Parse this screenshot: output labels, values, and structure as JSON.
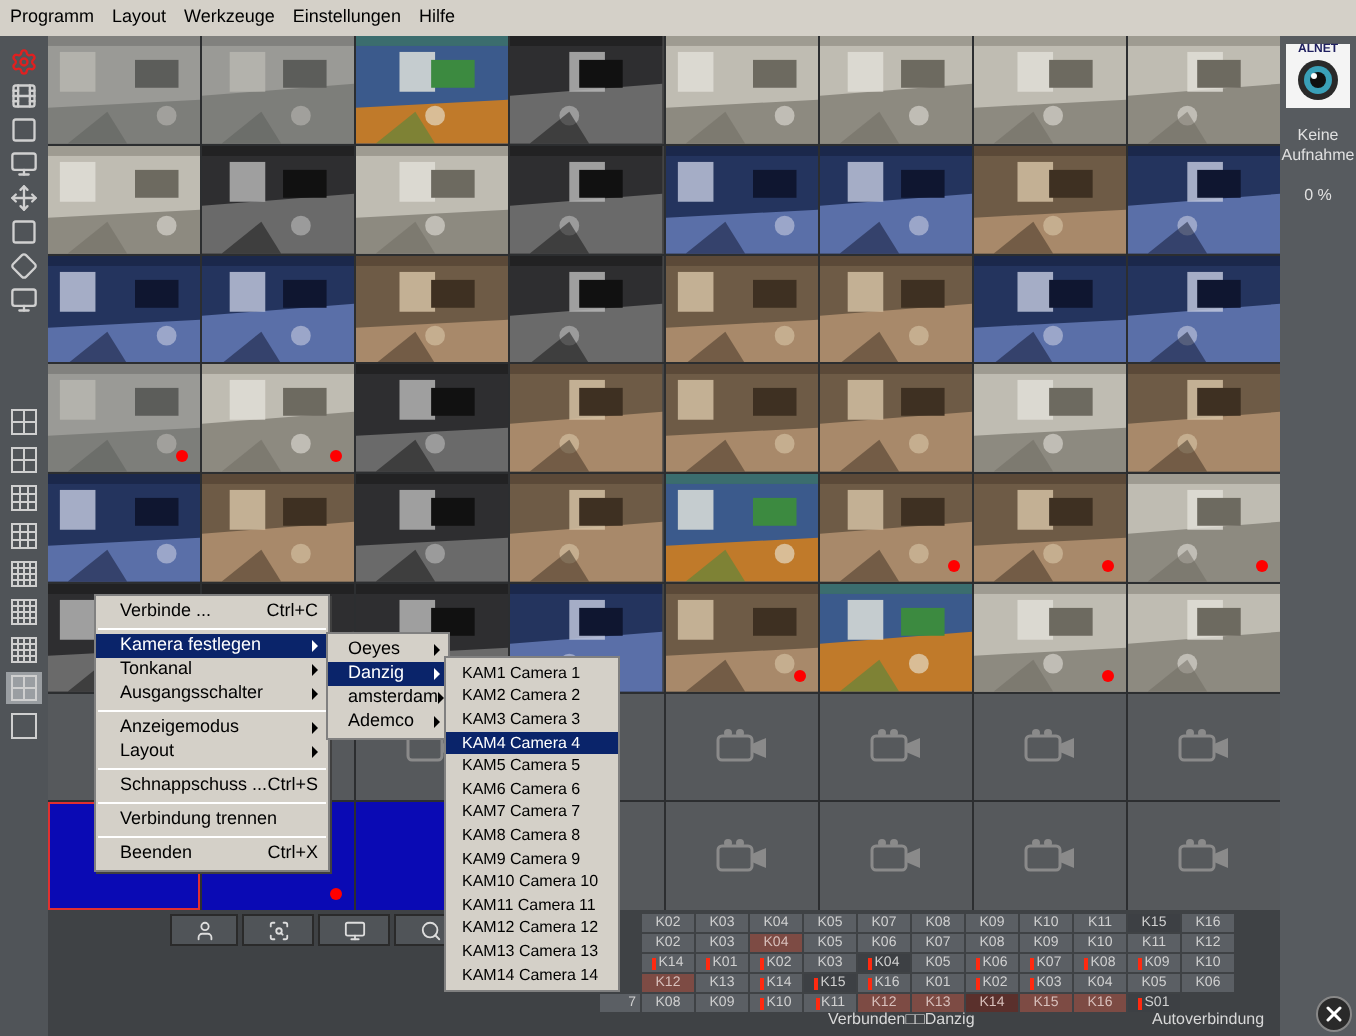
{
  "menu_bar": [
    "Programm",
    "Layout",
    "Werkzeuge",
    "Einstellungen",
    "Hilfe"
  ],
  "camera_grid": [
    [
      {
        "kind": "picture",
        "recording": false,
        "selected": false
      },
      {
        "kind": "picture",
        "recording": false,
        "selected": false
      },
      {
        "kind": "picture",
        "recording": false,
        "selected": false
      },
      {
        "kind": "picture",
        "recording": false,
        "selected": false
      },
      {
        "kind": "picture",
        "recording": false,
        "selected": false
      },
      {
        "kind": "picture",
        "recording": false,
        "selected": false
      },
      {
        "kind": "picture",
        "recording": false,
        "selected": false
      },
      {
        "kind": "picture",
        "recording": false,
        "selected": false
      }
    ],
    [
      {
        "kind": "picture",
        "recording": false,
        "selected": false
      },
      {
        "kind": "picture",
        "recording": false,
        "selected": false
      },
      {
        "kind": "picture",
        "recording": false,
        "selected": false
      },
      {
        "kind": "picture",
        "recording": false,
        "selected": false
      },
      {
        "kind": "picture",
        "recording": false,
        "selected": false
      },
      {
        "kind": "picture",
        "recording": false,
        "selected": false
      },
      {
        "kind": "picture",
        "recording": false,
        "selected": false
      },
      {
        "kind": "picture",
        "recording": false,
        "selected": false
      }
    ],
    [
      {
        "kind": "picture",
        "recording": false,
        "selected": false
      },
      {
        "kind": "picture",
        "recording": false,
        "selected": false
      },
      {
        "kind": "picture",
        "recording": false,
        "selected": false
      },
      {
        "kind": "picture",
        "recording": false,
        "selected": false
      },
      {
        "kind": "picture",
        "recording": false,
        "selected": false
      },
      {
        "kind": "picture",
        "recording": false,
        "selected": false
      },
      {
        "kind": "picture",
        "recording": false,
        "selected": false
      },
      {
        "kind": "picture",
        "recording": false,
        "selected": false
      }
    ],
    [
      {
        "kind": "picture",
        "recording": true,
        "selected": false
      },
      {
        "kind": "picture",
        "recording": true,
        "selected": false
      },
      {
        "kind": "picture",
        "recording": false,
        "selected": false
      },
      {
        "kind": "picture",
        "recording": false,
        "selected": false
      },
      {
        "kind": "picture",
        "recording": false,
        "selected": false
      },
      {
        "kind": "picture",
        "recording": false,
        "selected": false
      },
      {
        "kind": "picture",
        "recording": false,
        "selected": false
      },
      {
        "kind": "picture",
        "recording": false,
        "selected": false
      }
    ],
    [
      {
        "kind": "picture",
        "recording": false,
        "selected": false
      },
      {
        "kind": "picture",
        "recording": false,
        "selected": false
      },
      {
        "kind": "picture",
        "recording": false,
        "selected": false
      },
      {
        "kind": "picture",
        "recording": false,
        "selected": false
      },
      {
        "kind": "picture",
        "recording": false,
        "selected": false
      },
      {
        "kind": "picture",
        "recording": true,
        "selected": false
      },
      {
        "kind": "picture",
        "recording": true,
        "selected": false
      },
      {
        "kind": "picture",
        "recording": true,
        "selected": false
      }
    ],
    [
      {
        "kind": "picture",
        "selected": false
      },
      {
        "kind": "picture",
        "selected": false
      },
      {
        "kind": "picture",
        "selected": false
      },
      {
        "kind": "picture",
        "recording": false,
        "selected": false
      },
      {
        "kind": "picture",
        "recording": true,
        "selected": false
      },
      {
        "kind": "picture",
        "recording": false,
        "selected": false
      },
      {
        "kind": "picture",
        "recording": true,
        "selected": false
      },
      {
        "kind": "picture",
        "recording": false,
        "selected": false
      }
    ],
    [
      {
        "kind": "empty",
        "selected": false
      },
      {
        "kind": "empty",
        "recording": false,
        "selected": false
      },
      {
        "kind": "empty",
        "selected": false
      },
      {
        "kind": "empty",
        "recording": false,
        "selected": false
      },
      {
        "kind": "empty",
        "recording": false,
        "selected": false
      },
      {
        "kind": "empty",
        "recording": false,
        "selected": false
      },
      {
        "kind": "empty",
        "recording": false,
        "selected": false
      },
      {
        "kind": "empty",
        "recording": false,
        "selected": false
      }
    ],
    [
      {
        "kind": "blank",
        "recording": false,
        "selected": true
      },
      {
        "kind": "blank",
        "recording": true,
        "selected": false
      },
      {
        "kind": "blank",
        "selected": false
      },
      {
        "kind": "empty",
        "recording": false,
        "selected": false
      },
      {
        "kind": "empty",
        "recording": false,
        "selected": false
      },
      {
        "kind": "empty",
        "recording": false,
        "selected": false
      },
      {
        "kind": "empty",
        "recording": false,
        "selected": false
      },
      {
        "kind": "empty",
        "recording": false,
        "selected": false
      }
    ]
  ],
  "layout_buttons": [
    {
      "selected": false
    },
    {
      "selected": false
    },
    {
      "selected": false
    },
    {
      "selected": false
    },
    {
      "selected": false
    },
    {
      "selected": false
    },
    {
      "selected": false
    },
    {
      "selected": true
    },
    {
      "selected": false
    }
  ],
  "side_panel": {
    "logo_text": "ALNET",
    "status_lines": [
      "Keine",
      "Aufnahme"
    ],
    "percent": "0 %"
  },
  "context_menu": {
    "items": [
      {
        "kind": "item",
        "label": "Verbinde ...",
        "shortcut": "Ctrl+C",
        "submenu": false,
        "selected": false
      },
      {
        "kind": "separator"
      },
      {
        "kind": "item",
        "label": "Kamera festlegen",
        "submenu": true,
        "selected": true
      },
      {
        "kind": "item",
        "label": "Tonkanal",
        "submenu": true,
        "selected": false
      },
      {
        "kind": "item",
        "label": "Ausgangsschalter",
        "submenu": true,
        "selected": false
      },
      {
        "kind": "separator"
      },
      {
        "kind": "item",
        "label": "Anzeigemodus",
        "submenu": true,
        "selected": false
      },
      {
        "kind": "item",
        "label": "Layout",
        "submenu": true,
        "selected": false
      },
      {
        "kind": "separator"
      },
      {
        "kind": "item",
        "label": "Schnappschuss ...",
        "shortcut": "Ctrl+S",
        "submenu": false,
        "selected": false
      },
      {
        "kind": "separator"
      },
      {
        "kind": "item",
        "label": "Verbindung trennen",
        "submenu": false,
        "selected": false
      },
      {
        "kind": "separator"
      },
      {
        "kind": "item",
        "label": "Beenden",
        "shortcut": "Ctrl+X",
        "submenu": false,
        "selected": false
      }
    ]
  },
  "site_menu": {
    "items": [
      {
        "label": "Oeyes",
        "selected": false
      },
      {
        "label": "Danzig",
        "selected": true
      },
      {
        "label": "amsterdam",
        "selected": false
      },
      {
        "label": "Ademco",
        "selected": false
      }
    ]
  },
  "camera_menu": {
    "items": [
      {
        "label": "KAM1 Camera 1",
        "selected": false
      },
      {
        "label": "KAM2 Camera 2",
        "selected": false
      },
      {
        "label": "KAM3 Camera 3",
        "selected": false
      },
      {
        "label": "KAM4 Camera 4",
        "selected": true
      },
      {
        "label": "KAM5 Camera 5",
        "selected": false
      },
      {
        "label": "KAM6 Camera 6",
        "selected": false
      },
      {
        "label": "KAM7 Camera 7",
        "selected": false
      },
      {
        "label": "KAM8 Camera 8",
        "selected": false
      },
      {
        "label": "KAM9 Camera 9",
        "selected": false
      },
      {
        "label": "KAM10 Camera 10",
        "selected": false
      },
      {
        "label": "KAM11 Camera 11",
        "selected": false
      },
      {
        "label": "KAM12 Camera 12",
        "selected": false
      },
      {
        "label": "KAM13 Camera 13",
        "selected": false
      },
      {
        "label": "KAM14 Camera 14",
        "selected": false
      }
    ]
  },
  "channel_grid": {
    "rows": [
      [
        {
          "label": "K02",
          "kind": "normal",
          "marked": false
        },
        {
          "label": "K03",
          "kind": "normal",
          "marked": false
        },
        {
          "label": "K04",
          "kind": "normal",
          "marked": false
        },
        {
          "label": "K05",
          "kind": "normal",
          "marked": false
        },
        {
          "label": "K07",
          "kind": "normal",
          "marked": false
        },
        {
          "label": "K08",
          "kind": "normal",
          "marked": false
        },
        {
          "label": "K09",
          "kind": "normal",
          "marked": false
        },
        {
          "label": "K10",
          "kind": "normal",
          "marked": false
        },
        {
          "label": "K11",
          "kind": "normal",
          "marked": false
        },
        {
          "label": "K15",
          "kind": "dark",
          "marked": false
        },
        {
          "label": "K16",
          "kind": "normal",
          "marked": false
        }
      ],
      [
        {
          "label": "K02",
          "kind": "normal",
          "marked": false
        },
        {
          "label": "K03",
          "kind": "normal",
          "marked": false
        },
        {
          "label": "K04",
          "kind": "alarm",
          "marked": false
        },
        {
          "label": "K05",
          "kind": "normal",
          "marked": false
        },
        {
          "label": "K06",
          "kind": "normal",
          "marked": false
        },
        {
          "label": "K07",
          "kind": "normal",
          "marked": false
        },
        {
          "label": "K08",
          "kind": "normal",
          "marked": false
        },
        {
          "label": "K09",
          "kind": "normal",
          "marked": false
        },
        {
          "label": "K10",
          "kind": "normal",
          "marked": false
        },
        {
          "label": "K11",
          "kind": "normal",
          "marked": false
        },
        {
          "label": "K12",
          "kind": "normal",
          "marked": false
        }
      ],
      [
        {
          "label": "K14",
          "kind": "normal",
          "marked": true
        },
        {
          "label": "K01",
          "kind": "normal",
          "marked": true
        },
        {
          "label": "K02",
          "kind": "normal",
          "marked": true
        },
        {
          "label": "K03",
          "kind": "normal",
          "marked": false
        },
        {
          "label": "K04",
          "kind": "dark",
          "marked": true
        },
        {
          "label": "K05",
          "kind": "normal",
          "marked": false
        },
        {
          "label": "K06",
          "kind": "normal",
          "marked": true
        },
        {
          "label": "K07",
          "kind": "normal",
          "marked": true
        },
        {
          "label": "K08",
          "kind": "normal",
          "marked": true
        },
        {
          "label": "K09",
          "kind": "normal",
          "marked": true
        },
        {
          "label": "K10",
          "kind": "normal",
          "marked": false
        }
      ],
      [
        {
          "label": "K12",
          "kind": "alarm",
          "marked": false
        },
        {
          "label": "K13",
          "kind": "normal",
          "marked": false
        },
        {
          "label": "K14",
          "kind": "normal",
          "marked": true
        },
        {
          "label": "K15",
          "kind": "dark",
          "marked": true
        },
        {
          "label": "K16",
          "kind": "normal",
          "marked": true
        },
        {
          "label": "K01",
          "kind": "normal",
          "marked": false
        },
        {
          "label": "K02",
          "kind": "normal",
          "marked": true
        },
        {
          "label": "K03",
          "kind": "normal",
          "marked": true
        },
        {
          "label": "K04",
          "kind": "normal",
          "marked": false
        },
        {
          "label": "K05",
          "kind": "normal",
          "marked": false
        },
        {
          "label": "K06",
          "kind": "normal",
          "marked": false
        }
      ],
      [
        {
          "label": "K08",
          "kind": "normal",
          "marked": false
        },
        {
          "label": "K09",
          "kind": "normal",
          "marked": false
        },
        {
          "label": "K10",
          "kind": "normal",
          "marked": true
        },
        {
          "label": "K11",
          "kind": "normal",
          "marked": true
        },
        {
          "label": "K12",
          "kind": "alarm",
          "marked": false
        },
        {
          "label": "K13",
          "kind": "alarm",
          "marked": false
        },
        {
          "label": "K14",
          "kind": "dark-alarm",
          "marked": false
        },
        {
          "label": "K15",
          "kind": "alarm",
          "marked": false
        },
        {
          "label": "K16",
          "kind": "alarm",
          "marked": false
        },
        {
          "label": "S01",
          "kind": "dark",
          "marked": true
        }
      ]
    ],
    "cut_cell": "7"
  },
  "status_bar": {
    "connection": "Verbunden□□Danzig",
    "mode": "Autoverbindung"
  }
}
